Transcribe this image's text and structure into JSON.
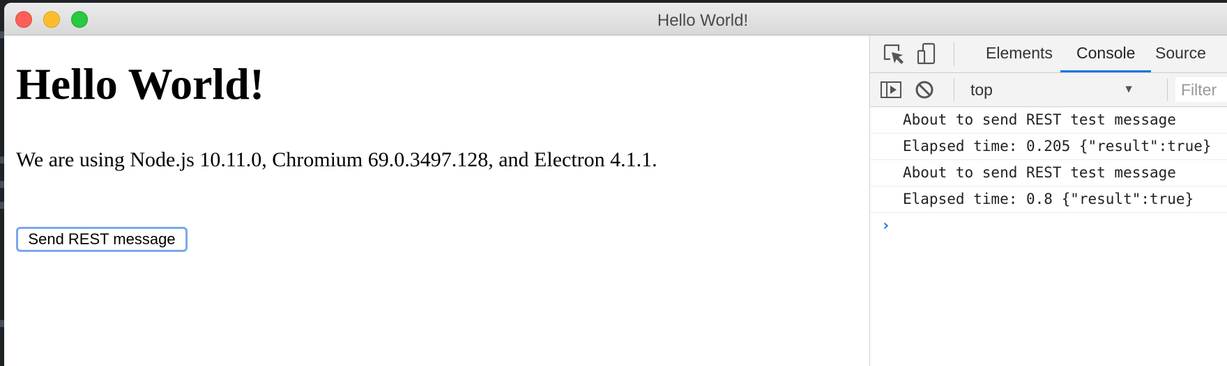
{
  "window": {
    "title": "Hello World!"
  },
  "page": {
    "heading": "Hello World!",
    "paragraph": "We are using Node.js 10.11.0, Chromium 69.0.3497.128, and Electron 4.1.1.",
    "send_button": "Send REST message"
  },
  "devtools": {
    "tabs": [
      {
        "label": "Elements",
        "active": false
      },
      {
        "label": "Console",
        "active": true
      },
      {
        "label": "Source",
        "active": false
      }
    ],
    "context": "top",
    "filter_placeholder": "Filter",
    "console_lines": [
      "About to send REST test message",
      "Elapsed time: 0.205 {\"result\":true}",
      "About to send REST test message",
      "Elapsed time: 0.8 {\"result\":true}"
    ],
    "prompt_symbol": "›"
  },
  "colors": {
    "accent": "#1a73e8",
    "close": "#fc5f57",
    "minimize": "#fdbc2e",
    "maximize": "#29c940",
    "button_focus": "#7aa7ee"
  },
  "icons": [
    "inspect-element-icon",
    "device-toolbar-icon",
    "show-sidebar-icon",
    "clear-console-icon",
    "dropdown-arrow-icon"
  ]
}
